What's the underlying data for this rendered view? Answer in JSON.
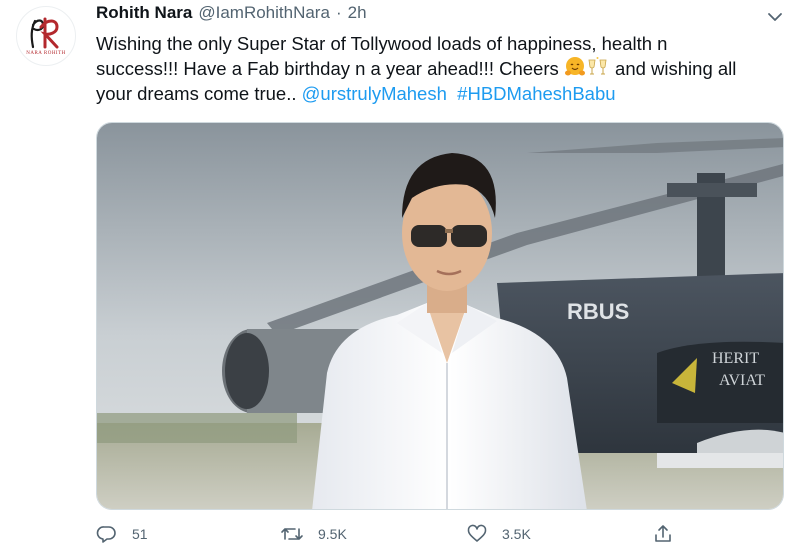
{
  "tweet": {
    "display_name": "Rohith Nara",
    "handle": "@IamRohithNara",
    "separator": "·",
    "time": "2h",
    "avatar_logo_text": "NARA ROHITH",
    "text": {
      "line1": "Wishing the only Super Star of Tollywood loads of happiness, health n",
      "line2_start": "success!!! Have a Fab birthday n a year ahead!!! Cheers ",
      "line2_end": " and wishing all",
      "line3_start": "your dreams come true.. ",
      "mention": "@urstrulyMahesh",
      "hashtag": "#HBDMaheshBabu"
    },
    "media": {
      "helicopter_text_1": "RBUS",
      "helicopter_text_2": "HERIT",
      "helicopter_text_3": "AVIAT"
    },
    "actions": {
      "replies": "51",
      "retweets": "9.5K",
      "likes": "3.5K"
    }
  },
  "icons": [
    "chevron-down-icon",
    "reply-icon",
    "retweet-icon",
    "like-icon",
    "share-icon",
    "hugging-face-emoji",
    "clinking-glasses-emoji"
  ],
  "colors": {
    "link": "#1d9bf0",
    "muted": "#536471",
    "text": "#0f1419",
    "logo": "#b3282d"
  }
}
